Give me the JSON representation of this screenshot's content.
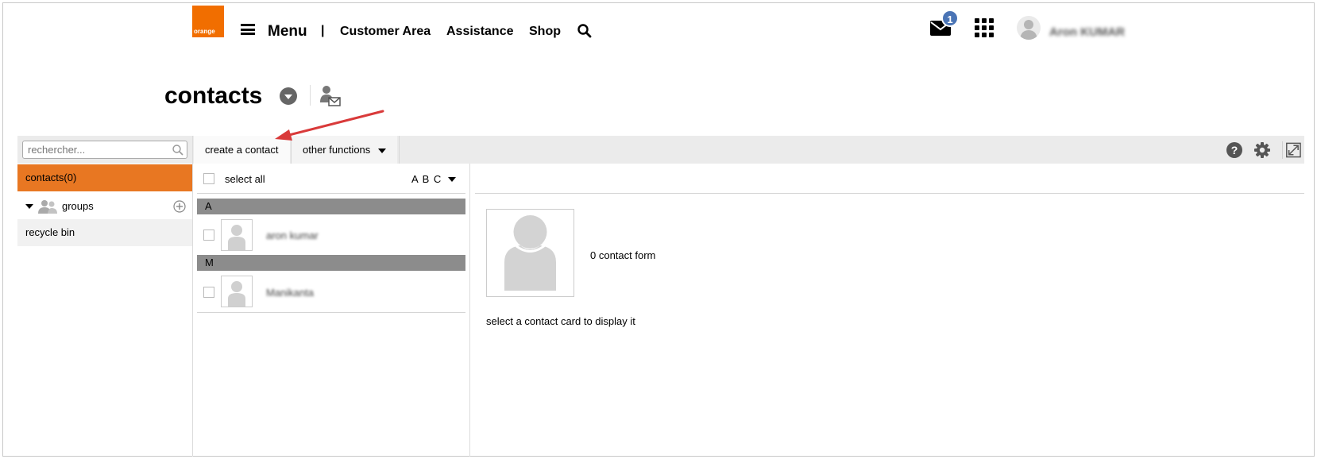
{
  "brand": {
    "logo_text": "orange",
    "accent_color": "#f16e00",
    "sidebar_active_color": "#e87722"
  },
  "nav": {
    "menu_label": "Menu",
    "separator": "|",
    "links": [
      "Customer Area",
      "Assistance",
      "Shop"
    ],
    "mail_badge_count": "1",
    "user_name": "Aron KUMAR"
  },
  "page": {
    "title": "contacts"
  },
  "toolbar": {
    "search_placeholder": "rechercher...",
    "create_label": "create a contact",
    "other_label": "other functions",
    "help_label": "?"
  },
  "sidebar": {
    "contacts_label": "contacts(0)",
    "groups_label": "groups",
    "recycle_label": "recycle bin"
  },
  "list": {
    "select_all_label": "select all",
    "sort_label": "A B C",
    "sections": [
      {
        "letter": "A",
        "contact": "aron kumar"
      },
      {
        "letter": "M",
        "contact": "Manikanta"
      }
    ]
  },
  "detail": {
    "form_count_label": "0 contact form",
    "hint": "select a contact card to display it"
  },
  "icons": [
    "hamburger-icon",
    "search-icon",
    "mail-icon",
    "apps-grid-icon",
    "user-avatar-icon",
    "chevron-down-icon",
    "contact-mail-icon",
    "help-icon",
    "gear-icon",
    "expand-icon",
    "groups-icon",
    "add-circle-icon",
    "annotation-arrow"
  ]
}
